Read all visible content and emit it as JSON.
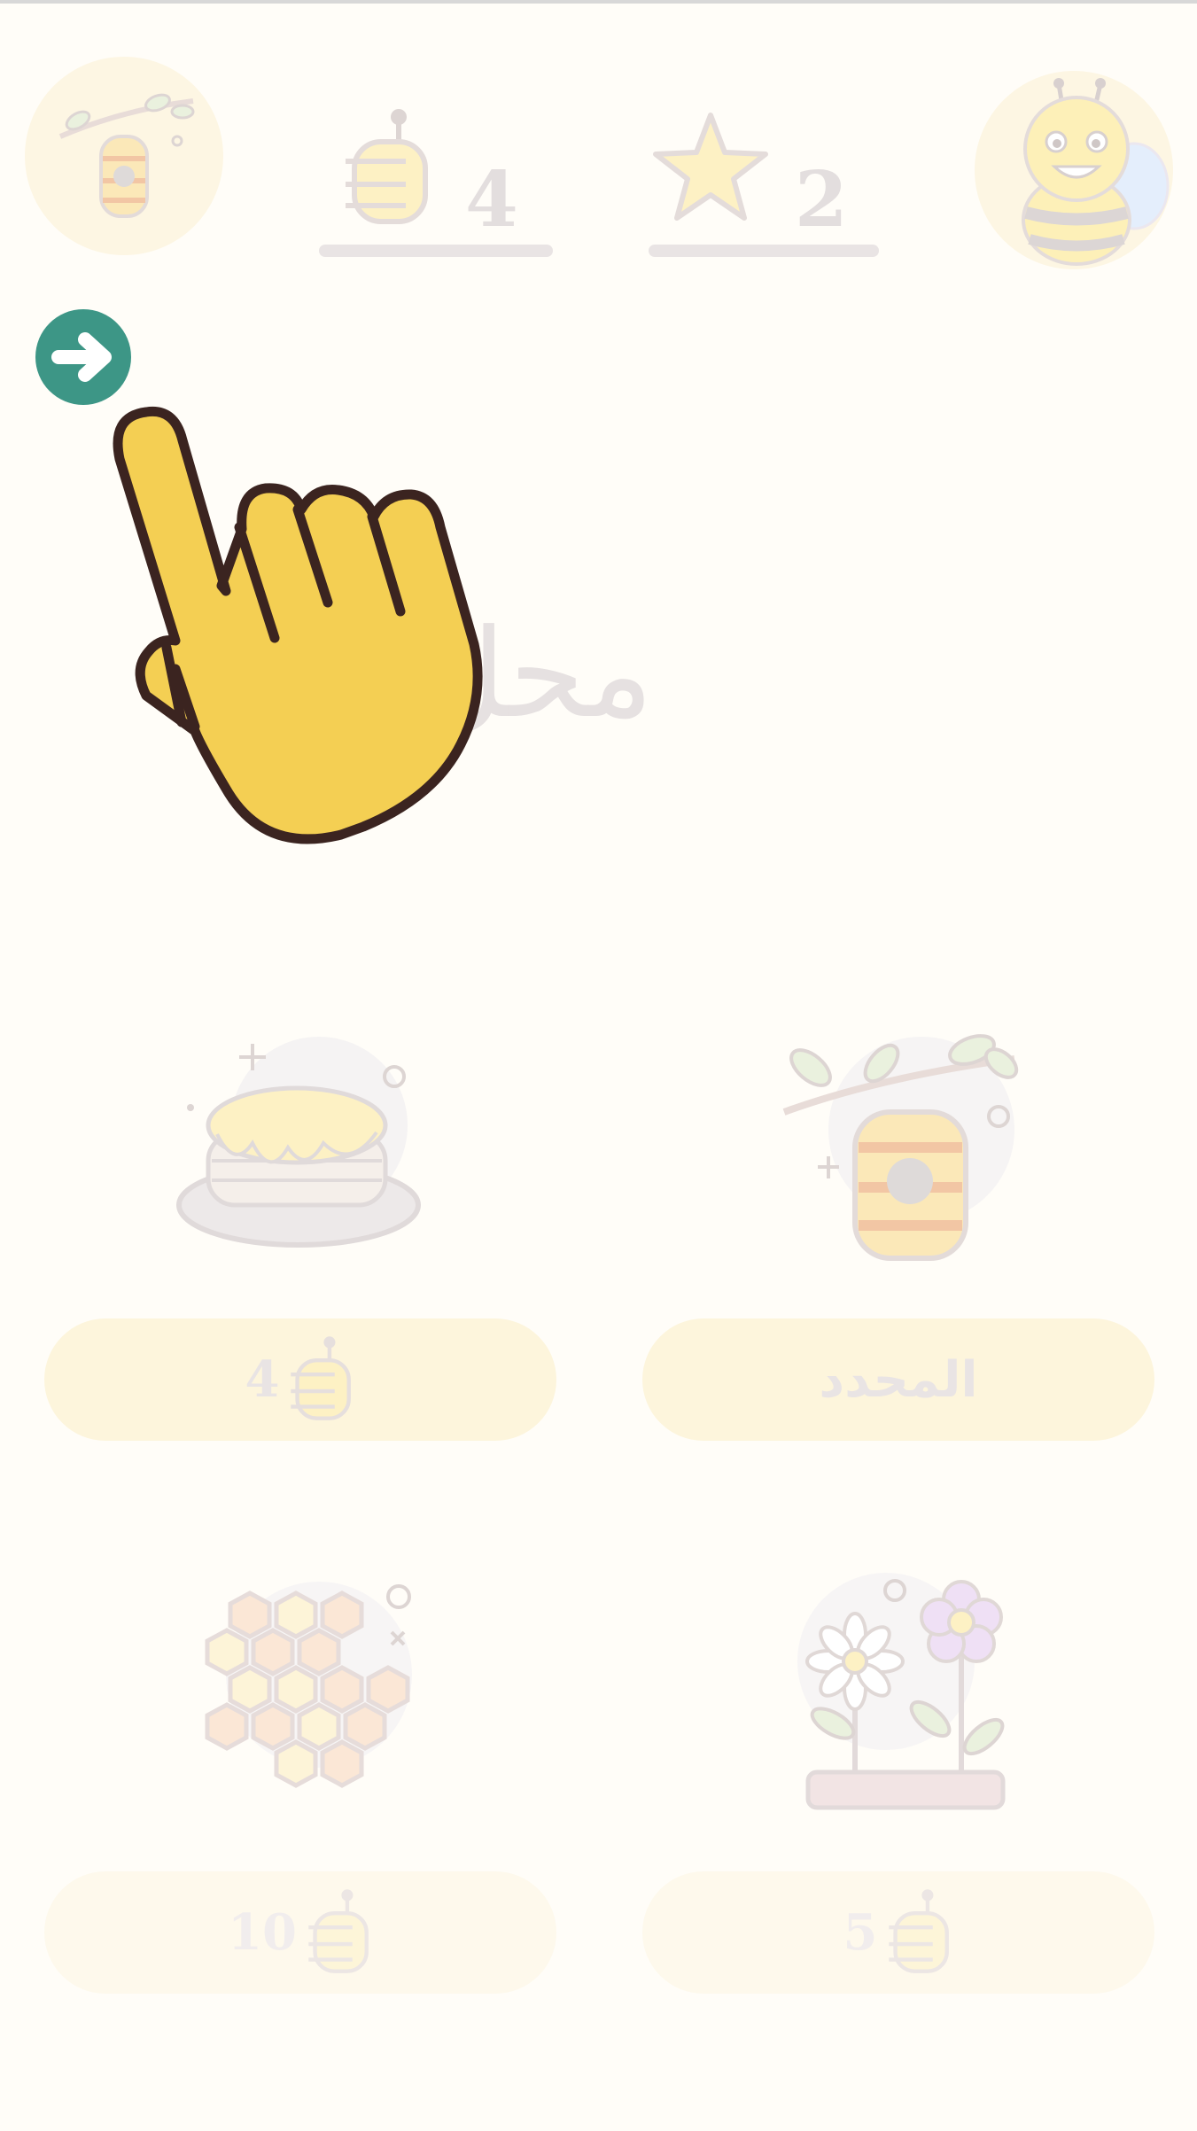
{
  "header": {
    "honey_count": "4",
    "star_count": "2"
  },
  "main": {
    "title": "محل"
  },
  "shop_items": [
    {
      "name": "pancakes",
      "price": "4"
    },
    {
      "name": "beehive",
      "label": "المحدد"
    },
    {
      "name": "honeycomb",
      "price": "10"
    },
    {
      "name": "flowers",
      "price": "5"
    }
  ],
  "icons": {
    "next": "arrow-right-icon",
    "tutorial": "pointing-hand-icon",
    "currency": "honey-pot-icon",
    "star": "star-icon"
  },
  "colors": {
    "accent": "#3d9686",
    "hand": "#f4cf53",
    "hand_outline": "#3b2420",
    "background": "#fffdf8",
    "pill": "#fdf5dc"
  }
}
